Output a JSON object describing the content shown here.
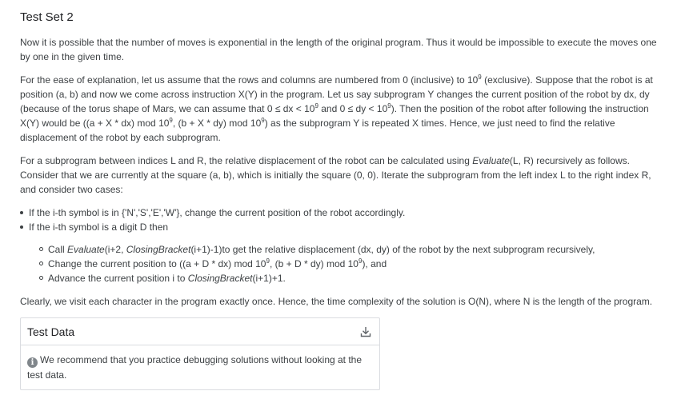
{
  "title": "Test Set 2",
  "para1": "Now it is possible that the number of moves is exponential in the length of the original program. Thus it would be impossible to execute the moves one by one in the given time.",
  "para2": {
    "s1": "For the ease of explanation, let us assume that the rows and columns are numbered from 0 (inclusive) to 10",
    "s1_sup": "9",
    "s2": " (exclusive). Suppose that the robot is at position (a, b) and now we come across instruction X(Y) in the program. Let us say subprogram Y changes the current position of the robot by dx, dy (because of the torus shape of Mars, we can assume that 0 ≤ dx < 10",
    "s2_sup": "9",
    "s3": " and 0 ≤ dy < 10",
    "s3_sup": "9",
    "s4": "). Then the position of the robot after following the instruction X(Y) would be ((a + X * dx) mod 10",
    "s4_sup": "9",
    "s5": ", (b + X * dy) mod 10",
    "s5_sup": "9",
    "s6": ") as the subprogram Y is repeated X times. Hence, we just need to find the relative displacement of the robot by each subprogram."
  },
  "para3": {
    "s1": "For a subprogram between indices L and R, the relative displacement of the robot can be calculated using ",
    "s1_em": "Evaluate",
    "s2": "(L, R) recursively as follows. Consider that we are currently at the square (a, b), which is initially the square (0, 0). Iterate the subprogram from the left index L to the right index R, and consider two cases:"
  },
  "bullets": [
    "If the i-th symbol is in {'N','S','E','W'}, change the current position of the robot accordingly.",
    "If the i-th symbol is a digit D then"
  ],
  "sub": {
    "item1_a": "Call ",
    "item1_em1": "Evaluate",
    "item1_b": "(i+2, ",
    "item1_em2": "ClosingBracket",
    "item1_c": "(i+1)-1)to get the relative displacement (dx, dy) of the robot by the next subprogram recursively,",
    "item2_a": "Change the current position to ((a + D * dx) mod 10",
    "item2_sup1": "9",
    "item2_b": ", (b + D * dy) mod 10",
    "item2_sup2": "9",
    "item2_c": "), and",
    "item3_a": "Advance the current position i to ",
    "item3_em": "ClosingBracket",
    "item3_b": "(i+1)+1."
  },
  "para4": "Clearly, we visit each character in the program exactly once. Hence, the time complexity of the solution is O(N), where N is the length of the program.",
  "card": {
    "title": "Test Data",
    "download_icon": "download-icon",
    "info_icon": "info-icon",
    "info_glyph": "i",
    "note": "We recommend that you practice debugging solutions without looking at the test data."
  }
}
